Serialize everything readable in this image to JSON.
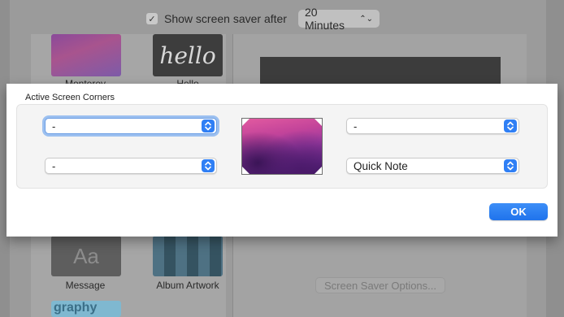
{
  "background": {
    "show_saver_checked": true,
    "show_saver_label": "Show screen saver after",
    "delay_select_value": "20 Minutes",
    "savers": [
      {
        "label": "Monterey"
      },
      {
        "label": "Hello",
        "thumb_text": "hello"
      },
      {
        "label": "Message",
        "thumb_text": "Aa"
      },
      {
        "label": "Album Artwork"
      },
      {
        "thumb_text": "graphy"
      }
    ],
    "options_button_label": "Screen Saver Options..."
  },
  "sheet": {
    "section_title": "Active Screen Corners",
    "corners": {
      "top_left": "-",
      "bottom_left": "-",
      "top_right": "-",
      "bottom_right": "Quick Note"
    },
    "ok_label": "OK"
  },
  "colors": {
    "accent": "#2f7ff5",
    "focus_ring": "#9cc0f0"
  }
}
